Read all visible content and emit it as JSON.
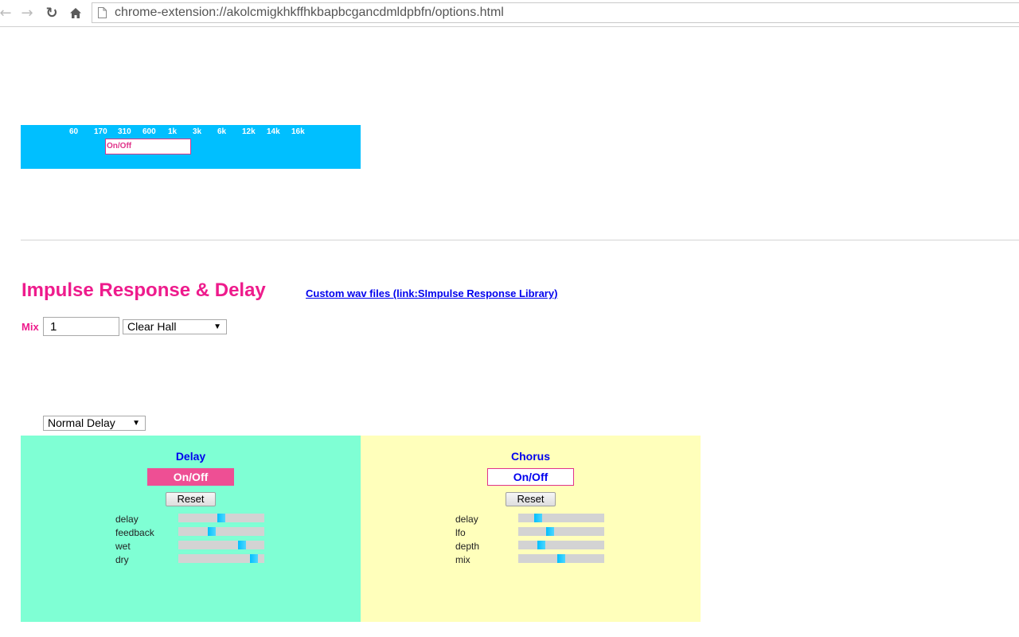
{
  "browser": {
    "url": "chrome-extension://akolcmigkhkffhkbapbcgancdmldpbfn/options.html"
  },
  "eq": {
    "frequencies": [
      "60",
      "170",
      "310",
      "600",
      "1k",
      "3k",
      "6k",
      "12k",
      "14k",
      "16k"
    ],
    "onoff_label": "On/Off"
  },
  "impulse": {
    "title": "Impulse Response & Delay",
    "link_text": "Custom wav files (link:SImpulse Response Library)",
    "mix_label": "Mix",
    "mix_value": "1",
    "hall_selected": "Clear Hall",
    "delay_type_selected": "Normal Delay"
  },
  "delay": {
    "title": "Delay",
    "onoff_label": "On/Off",
    "reset_label": "Reset",
    "params": [
      {
        "label": "delay",
        "value": 0.5
      },
      {
        "label": "feedback",
        "value": 0.38
      },
      {
        "label": "wet",
        "value": 0.77
      },
      {
        "label": "dry",
        "value": 0.92
      }
    ]
  },
  "chorus": {
    "title": "Chorus",
    "onoff_label": "On/Off",
    "reset_label": "Reset",
    "params": [
      {
        "label": "delay",
        "value": 0.2
      },
      {
        "label": "lfo",
        "value": 0.36
      },
      {
        "label": "depth",
        "value": 0.24
      },
      {
        "label": "mix",
        "value": 0.5
      }
    ]
  },
  "colors": {
    "eq_bg": "#00bfff",
    "accent_pink": "#ee1b8c",
    "delay_bg": "#7fffd4",
    "chorus_bg": "#ffffbb",
    "link_blue": "#0000ee"
  }
}
